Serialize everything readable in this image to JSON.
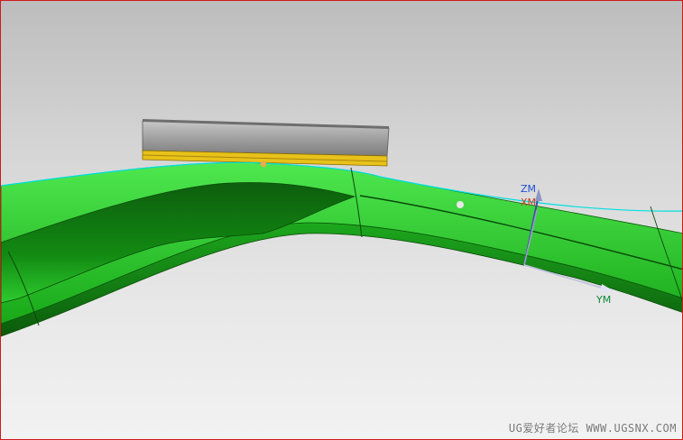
{
  "viewport": {
    "title": "",
    "colors": {
      "border": "#d01818",
      "body_green": "#1fb51f",
      "body_green_dark": "#0e6a0e",
      "disc_gray": "#9a9a9a",
      "disc_yellow": "#e8c21a",
      "edge_cyan": "#00e0e0"
    }
  },
  "csys": {
    "z_label": "ZM",
    "x_label": "XM",
    "y_label": "YM",
    "z_color": "#1f4fd6",
    "x_color": "#d03a1a",
    "y_color": "#0d8a3a"
  },
  "watermark": {
    "text": "UG爱好者论坛 WWW.UGSNX.COM"
  }
}
